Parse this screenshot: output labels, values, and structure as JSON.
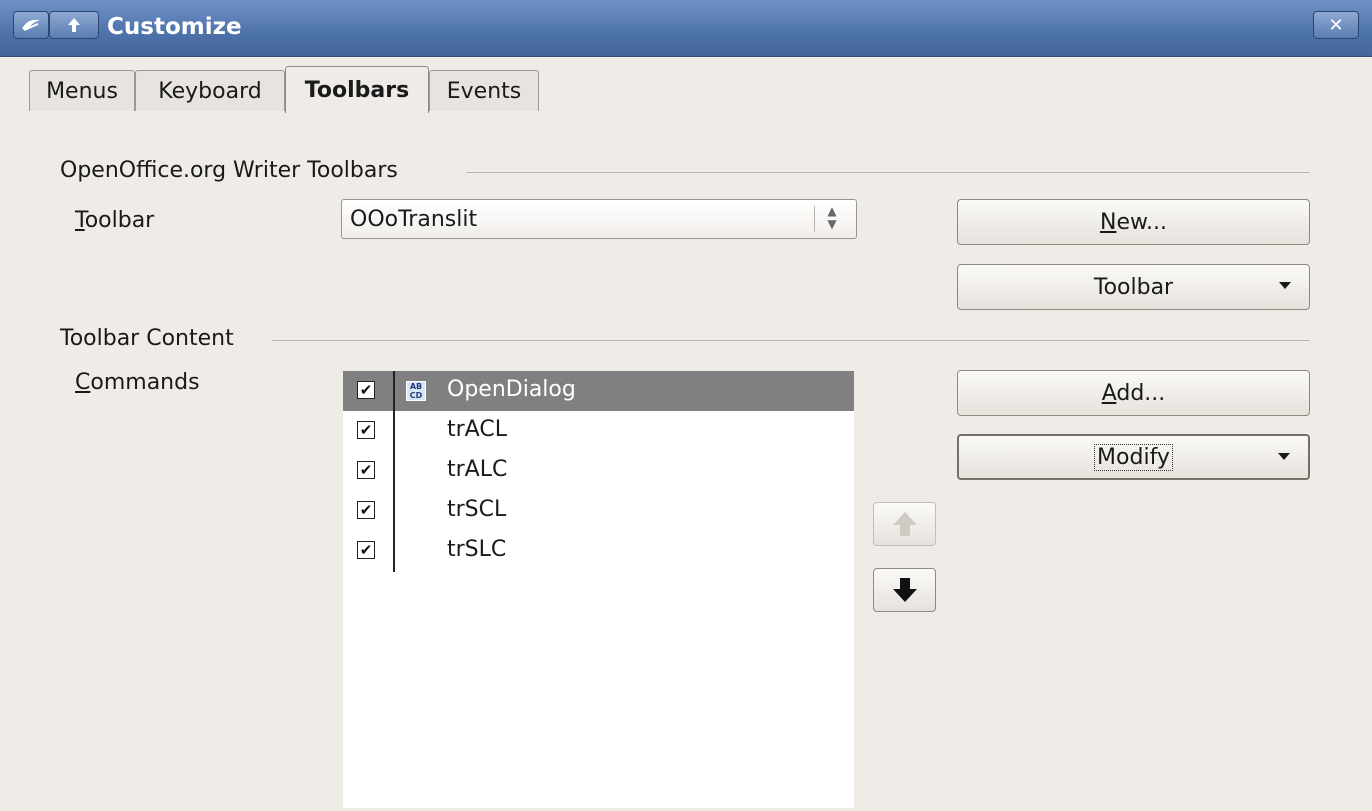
{
  "window": {
    "title": "Customize",
    "close_glyph": "✕",
    "icons": [
      "app-icon",
      "shade-up-icon",
      "close-icon"
    ]
  },
  "tabs": [
    {
      "label": "Menus",
      "active": false
    },
    {
      "label": "Keyboard",
      "active": false
    },
    {
      "label": "Toolbars",
      "active": true
    },
    {
      "label": "Events",
      "active": false
    }
  ],
  "toolbars_section": {
    "title": "OpenOffice.org Writer Toolbars",
    "toolbar_label_mnemonic": "T",
    "toolbar_label_rest": "oolbar",
    "toolbar_value": "OOoTranslit",
    "new_button_mnemonic": "N",
    "new_button_rest": "ew...",
    "toolbar_menu_button": "Toolbar"
  },
  "content_section": {
    "title": "Toolbar Content",
    "commands_label_mnemonic": "C",
    "commands_label_rest": "ommands",
    "commands": [
      {
        "label": "OpenDialog",
        "checked": true,
        "selected": true,
        "has_icon": true
      },
      {
        "label": "trACL",
        "checked": true,
        "selected": false,
        "has_icon": false
      },
      {
        "label": "trALC",
        "checked": true,
        "selected": false,
        "has_icon": false
      },
      {
        "label": "trSCL",
        "checked": true,
        "selected": false,
        "has_icon": false
      },
      {
        "label": "trSLC",
        "checked": true,
        "selected": false,
        "has_icon": false
      }
    ],
    "add_button_mnemonic": "A",
    "add_button_rest": "dd...",
    "modify_button": "Modify",
    "move_up_enabled": false,
    "move_down_enabled": true
  },
  "colors": {
    "titlebar": "#4d71a9",
    "dialog_bg": "#efebe7",
    "selected_row": "#808080"
  }
}
